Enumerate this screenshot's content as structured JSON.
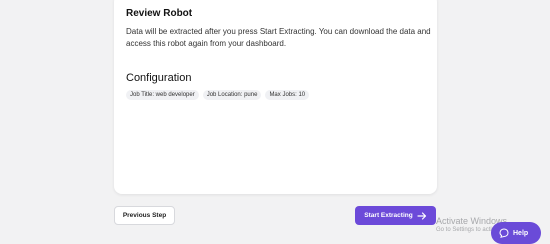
{
  "review": {
    "title": "Review Robot",
    "description": "Data will be extracted after you press Start Extracting. You can download the data and access this robot again from your dashboard."
  },
  "configuration": {
    "title": "Configuration",
    "tags": [
      "Job Title: web developer",
      "Job Location: pune",
      "Max Jobs: 10"
    ]
  },
  "actions": {
    "previous_label": "Previous Step",
    "start_label": "Start Extracting"
  },
  "watermark": {
    "title": "Activate Windows",
    "subtitle": "Go to Settings to activate Windows."
  },
  "help": {
    "label": "Help"
  },
  "colors": {
    "accent": "#6c4ad9",
    "background": "#f2f2f3"
  },
  "icons": {
    "start": "arrow-right-icon",
    "help": "chat-icon"
  }
}
